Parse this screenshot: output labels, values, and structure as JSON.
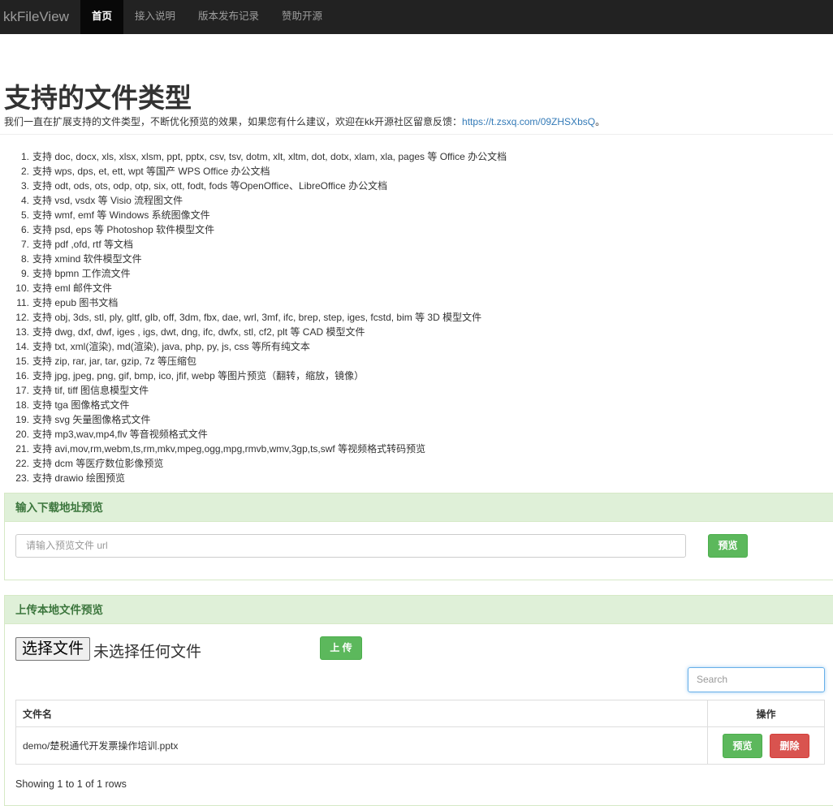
{
  "navbar": {
    "brand": "kkFileView",
    "items": [
      "首页",
      "接入说明",
      "版本发布记录",
      "赞助开源"
    ]
  },
  "page": {
    "title": "支持的文件类型",
    "intro_text": "我们一直在扩展支持的文件类型，不断优化预览的效果，如果您有什么建议，欢迎在kk开源社区留意反馈：",
    "intro_link": "https://t.zsxq.com/09ZHSXbsQ",
    "intro_end": "。"
  },
  "file_types": [
    "支持 doc, docx, xls, xlsx, xlsm, ppt, pptx, csv, tsv, dotm, xlt, xltm, dot, dotx, xlam, xla, pages 等 Office 办公文档",
    "支持 wps, dps, et, ett, wpt 等国产 WPS Office 办公文档",
    "支持 odt, ods, ots, odp, otp, six, ott, fodt, fods 等OpenOffice、LibreOffice 办公文档",
    "支持 vsd, vsdx 等 Visio 流程图文件",
    "支持 wmf, emf 等 Windows 系统图像文件",
    "支持 psd, eps 等 Photoshop 软件模型文件",
    "支持 pdf ,ofd, rtf 等文档",
    "支持 xmind 软件模型文件",
    "支持 bpmn 工作流文件",
    "支持 eml 邮件文件",
    "支持 epub 图书文档",
    "支持 obj, 3ds, stl, ply, gltf, glb, off, 3dm, fbx, dae, wrl, 3mf, ifc, brep, step, iges, fcstd, bim 等 3D 模型文件",
    "支持 dwg, dxf, dwf, iges , igs, dwt, dng, ifc, dwfx, stl, cf2, plt 等 CAD 模型文件",
    "支持 txt, xml(渲染), md(渲染), java, php, py, js, css 等所有纯文本",
    "支持 zip, rar, jar, tar, gzip, 7z 等压缩包",
    "支持 jpg, jpeg, png, gif, bmp, ico, jfif, webp 等图片预览（翻转，缩放，镜像）",
    "支持 tif, tiff 图信息模型文件",
    "支持 tga 图像格式文件",
    "支持 svg 矢量图像格式文件",
    "支持 mp3,wav,mp4,flv 等音视频格式文件",
    "支持 avi,mov,rm,webm,ts,rm,mkv,mpeg,ogg,mpg,rmvb,wmv,3gp,ts,swf 等视频格式转码预览",
    "支持 dcm 等医疗数位影像预览",
    "支持 drawio 绘图预览"
  ],
  "url_panel": {
    "heading": "输入下载地址预览",
    "placeholder": "请输入预览文件 url",
    "button": "预览"
  },
  "upload_panel": {
    "heading": "上传本地文件预览",
    "choose_button": "选择文件",
    "no_file": "未选择任何文件",
    "upload_button": "上 传",
    "search_placeholder": "Search",
    "table": {
      "col_name": "文件名",
      "col_action": "操作",
      "rows": [
        {
          "name": "demo/楚税通代开发票操作培训.pptx",
          "preview": "预览",
          "delete": "删除"
        }
      ]
    },
    "rows_info": "Showing 1 to 1 of 1 rows"
  },
  "colors": {
    "navbar_bg": "#222222",
    "panel_heading_bg": "#dff0d8",
    "panel_heading_text": "#3c763d",
    "success": "#5cb85c",
    "danger": "#d9534f",
    "link": "#337ab7"
  }
}
